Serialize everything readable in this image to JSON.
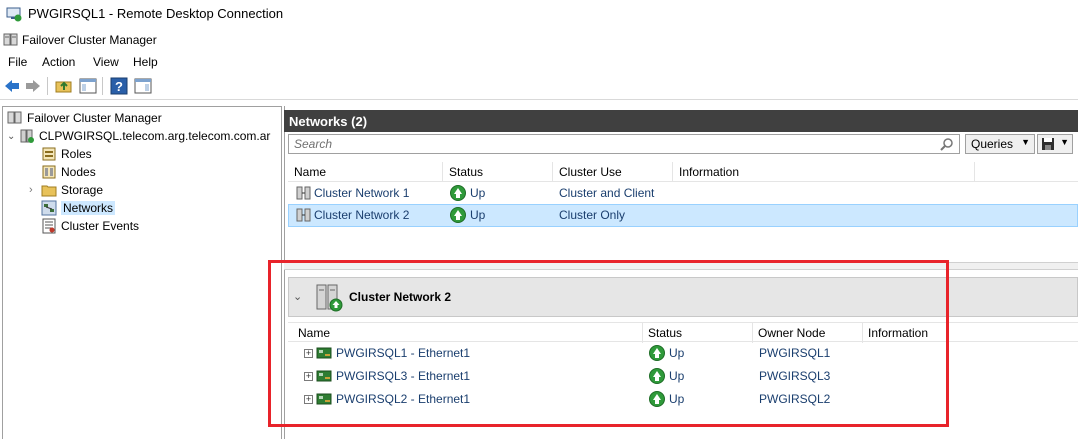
{
  "window": {
    "title": "PWGIRSQL1 - Remote Desktop Connection"
  },
  "app": {
    "title": "Failover Cluster Manager"
  },
  "menu": [
    "File",
    "Action",
    "View",
    "Help"
  ],
  "tree": {
    "root": "Failover Cluster Manager",
    "cluster": "CLPWGIRSQL.telecom.arg.telecom.com.ar",
    "items": [
      "Roles",
      "Nodes",
      "Storage",
      "Networks",
      "Cluster Events"
    ],
    "selected": "Networks"
  },
  "networks_panel": {
    "title": "Networks (2)",
    "search_placeholder": "Search",
    "queries_label": "Queries",
    "columns": [
      "Name",
      "Status",
      "Cluster Use",
      "Information"
    ],
    "rows": [
      {
        "name": "Cluster Network 1",
        "status": "Up",
        "cluster_use": "Cluster and Client",
        "information": ""
      },
      {
        "name": "Cluster Network 2",
        "status": "Up",
        "cluster_use": "Cluster Only",
        "information": ""
      }
    ],
    "selected_row": 1
  },
  "detail_panel": {
    "title": "Cluster Network 2",
    "columns": [
      "Name",
      "Status",
      "Owner Node",
      "Information"
    ],
    "rows": [
      {
        "name": "PWGIRSQL1 - Ethernet1",
        "status": "Up",
        "owner_node": "PWGIRSQL1",
        "information": ""
      },
      {
        "name": "PWGIRSQL3 - Ethernet1",
        "status": "Up",
        "owner_node": "PWGIRSQL3",
        "information": ""
      },
      {
        "name": "PWGIRSQL2 - Ethernet1",
        "status": "Up",
        "owner_node": "PWGIRSQL2",
        "information": ""
      }
    ]
  },
  "colors": {
    "header_bg": "#404040",
    "selection": "#cce8ff",
    "link_text": "#1a3e6e",
    "status_up": "#2f9a3a",
    "highlight_box": "#e8232a"
  }
}
